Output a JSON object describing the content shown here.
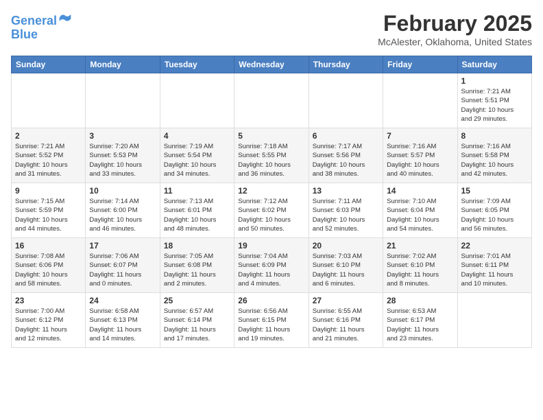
{
  "header": {
    "logo_line1": "General",
    "logo_line2": "Blue",
    "month_title": "February 2025",
    "location": "McAlester, Oklahoma, United States"
  },
  "days_of_week": [
    "Sunday",
    "Monday",
    "Tuesday",
    "Wednesday",
    "Thursday",
    "Friday",
    "Saturday"
  ],
  "weeks": [
    [
      {
        "day": "",
        "info": ""
      },
      {
        "day": "",
        "info": ""
      },
      {
        "day": "",
        "info": ""
      },
      {
        "day": "",
        "info": ""
      },
      {
        "day": "",
        "info": ""
      },
      {
        "day": "",
        "info": ""
      },
      {
        "day": "1",
        "info": "Sunrise: 7:21 AM\nSunset: 5:51 PM\nDaylight: 10 hours\nand 29 minutes."
      }
    ],
    [
      {
        "day": "2",
        "info": "Sunrise: 7:21 AM\nSunset: 5:52 PM\nDaylight: 10 hours\nand 31 minutes."
      },
      {
        "day": "3",
        "info": "Sunrise: 7:20 AM\nSunset: 5:53 PM\nDaylight: 10 hours\nand 33 minutes."
      },
      {
        "day": "4",
        "info": "Sunrise: 7:19 AM\nSunset: 5:54 PM\nDaylight: 10 hours\nand 34 minutes."
      },
      {
        "day": "5",
        "info": "Sunrise: 7:18 AM\nSunset: 5:55 PM\nDaylight: 10 hours\nand 36 minutes."
      },
      {
        "day": "6",
        "info": "Sunrise: 7:17 AM\nSunset: 5:56 PM\nDaylight: 10 hours\nand 38 minutes."
      },
      {
        "day": "7",
        "info": "Sunrise: 7:16 AM\nSunset: 5:57 PM\nDaylight: 10 hours\nand 40 minutes."
      },
      {
        "day": "8",
        "info": "Sunrise: 7:16 AM\nSunset: 5:58 PM\nDaylight: 10 hours\nand 42 minutes."
      }
    ],
    [
      {
        "day": "9",
        "info": "Sunrise: 7:15 AM\nSunset: 5:59 PM\nDaylight: 10 hours\nand 44 minutes."
      },
      {
        "day": "10",
        "info": "Sunrise: 7:14 AM\nSunset: 6:00 PM\nDaylight: 10 hours\nand 46 minutes."
      },
      {
        "day": "11",
        "info": "Sunrise: 7:13 AM\nSunset: 6:01 PM\nDaylight: 10 hours\nand 48 minutes."
      },
      {
        "day": "12",
        "info": "Sunrise: 7:12 AM\nSunset: 6:02 PM\nDaylight: 10 hours\nand 50 minutes."
      },
      {
        "day": "13",
        "info": "Sunrise: 7:11 AM\nSunset: 6:03 PM\nDaylight: 10 hours\nand 52 minutes."
      },
      {
        "day": "14",
        "info": "Sunrise: 7:10 AM\nSunset: 6:04 PM\nDaylight: 10 hours\nand 54 minutes."
      },
      {
        "day": "15",
        "info": "Sunrise: 7:09 AM\nSunset: 6:05 PM\nDaylight: 10 hours\nand 56 minutes."
      }
    ],
    [
      {
        "day": "16",
        "info": "Sunrise: 7:08 AM\nSunset: 6:06 PM\nDaylight: 10 hours\nand 58 minutes."
      },
      {
        "day": "17",
        "info": "Sunrise: 7:06 AM\nSunset: 6:07 PM\nDaylight: 11 hours\nand 0 minutes."
      },
      {
        "day": "18",
        "info": "Sunrise: 7:05 AM\nSunset: 6:08 PM\nDaylight: 11 hours\nand 2 minutes."
      },
      {
        "day": "19",
        "info": "Sunrise: 7:04 AM\nSunset: 6:09 PM\nDaylight: 11 hours\nand 4 minutes."
      },
      {
        "day": "20",
        "info": "Sunrise: 7:03 AM\nSunset: 6:10 PM\nDaylight: 11 hours\nand 6 minutes."
      },
      {
        "day": "21",
        "info": "Sunrise: 7:02 AM\nSunset: 6:10 PM\nDaylight: 11 hours\nand 8 minutes."
      },
      {
        "day": "22",
        "info": "Sunrise: 7:01 AM\nSunset: 6:11 PM\nDaylight: 11 hours\nand 10 minutes."
      }
    ],
    [
      {
        "day": "23",
        "info": "Sunrise: 7:00 AM\nSunset: 6:12 PM\nDaylight: 11 hours\nand 12 minutes."
      },
      {
        "day": "24",
        "info": "Sunrise: 6:58 AM\nSunset: 6:13 PM\nDaylight: 11 hours\nand 14 minutes."
      },
      {
        "day": "25",
        "info": "Sunrise: 6:57 AM\nSunset: 6:14 PM\nDaylight: 11 hours\nand 17 minutes."
      },
      {
        "day": "26",
        "info": "Sunrise: 6:56 AM\nSunset: 6:15 PM\nDaylight: 11 hours\nand 19 minutes."
      },
      {
        "day": "27",
        "info": "Sunrise: 6:55 AM\nSunset: 6:16 PM\nDaylight: 11 hours\nand 21 minutes."
      },
      {
        "day": "28",
        "info": "Sunrise: 6:53 AM\nSunset: 6:17 PM\nDaylight: 11 hours\nand 23 minutes."
      },
      {
        "day": "",
        "info": ""
      }
    ]
  ]
}
